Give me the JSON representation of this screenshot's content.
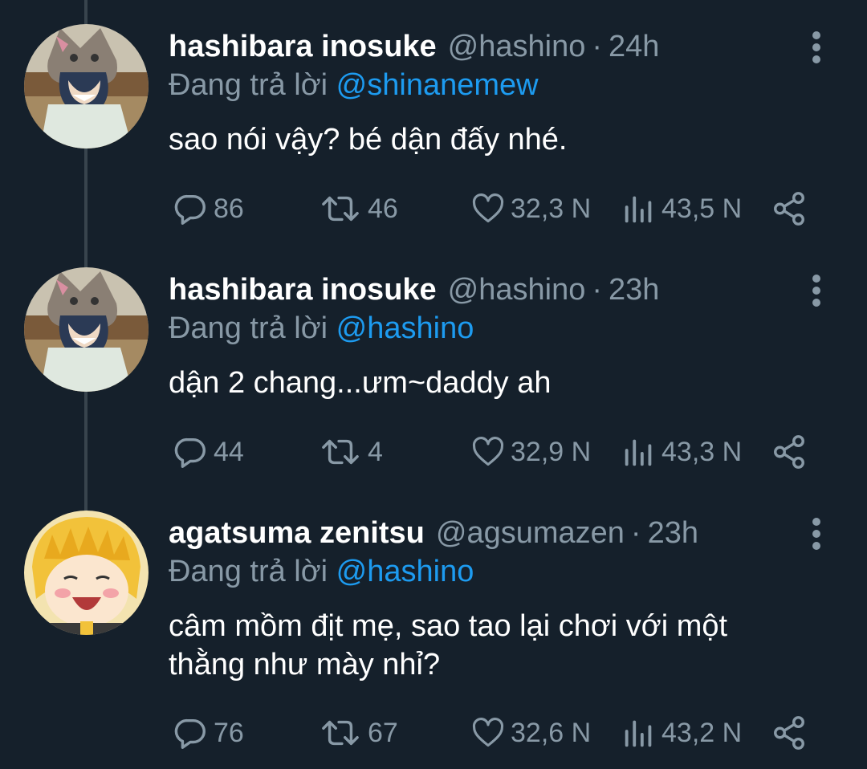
{
  "tweets": [
    {
      "author_name": "hashibara inosuke",
      "handle": "@hashino",
      "separator": "·",
      "time": "24h",
      "replying_label": "Đang trả lời",
      "replying_to": "@shinanemew",
      "text": "sao nói vậy? bé dận đấy nhé.",
      "replies": "86",
      "retweets": "46",
      "likes": "32,3 N",
      "views": "43,5 N"
    },
    {
      "author_name": "hashibara inosuke",
      "handle": "@hashino",
      "separator": "·",
      "time": "23h",
      "replying_label": "Đang trả lời",
      "replying_to": "@hashino",
      "text": "dận 2 chang...ưm~daddy ah",
      "replies": "44",
      "retweets": "4",
      "likes": "32,9 N",
      "views": "43,3 N"
    },
    {
      "author_name": "agatsuma zenitsu",
      "handle": "@agsumazen",
      "separator": "·",
      "time": "23h",
      "replying_label": "Đang trả lời",
      "replying_to": "@hashino",
      "text": "câm mồm địt mẹ, sao tao lại chơi với một thằng như mày nhỉ?",
      "replies": "76",
      "retweets": "67",
      "likes": "32,6 N",
      "views": "43,2 N"
    }
  ],
  "icons": {
    "reply": "reply-icon",
    "retweet": "retweet-icon",
    "like": "heart-icon",
    "views": "views-icon",
    "share": "share-icon",
    "more": "more-vertical-icon"
  },
  "colors": {
    "background": "#15202b",
    "text": "#ffffff",
    "muted": "#8899a6",
    "link": "#1d9bf0",
    "thread_line": "#38444d"
  }
}
